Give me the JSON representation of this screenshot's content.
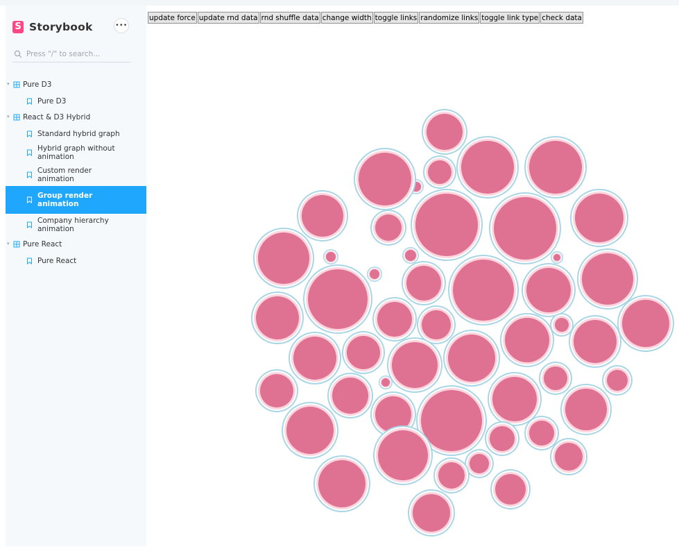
{
  "brand": {
    "name": "Storybook",
    "logo_letter": "S",
    "accent": "#ff4785"
  },
  "search": {
    "placeholder": "Press \"/\" to search..."
  },
  "menu_button": {
    "label": "•••"
  },
  "nav": [
    {
      "kind": "group",
      "label": "Pure D3"
    },
    {
      "kind": "story",
      "label": "Pure D3"
    },
    {
      "kind": "group",
      "label": "React & D3 Hybrid"
    },
    {
      "kind": "story",
      "label": "Standard hybrid graph"
    },
    {
      "kind": "story",
      "label": "Hybrid graph without animation"
    },
    {
      "kind": "story",
      "label": "Custom render animation"
    },
    {
      "kind": "story",
      "label": "Group render animation",
      "active": true
    },
    {
      "kind": "story",
      "label": "Company hierarchy animation"
    },
    {
      "kind": "group",
      "label": "Pure React"
    },
    {
      "kind": "story",
      "label": "Pure React"
    }
  ],
  "toolbar": [
    "update force",
    "update rnd data",
    "rnd shuffle data",
    "change width",
    "toggle links",
    "randomize links",
    "toggle link type",
    "check data"
  ],
  "colors": {
    "selection": "#1ea7fd",
    "node_fill": "#df7192",
    "node_ring": "#ffd5e0",
    "node_outer": "#a8d6e6",
    "sidebar_bg": "#f6f9fc"
  },
  "graph": {
    "node_count": 60
  }
}
